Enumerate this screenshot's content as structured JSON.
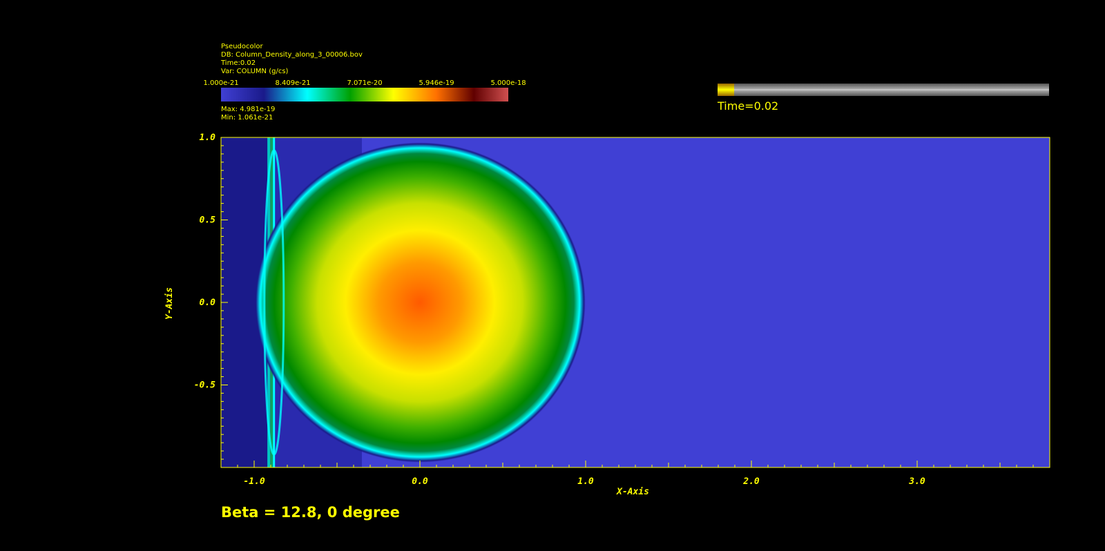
{
  "legend": {
    "plot_type": "Pseudocolor",
    "db": "DB: Column_Density_along_3_00006.bov",
    "time": "Time:0.02",
    "var": "Var: COLUMN (g/cs)",
    "ticks": [
      "1.000e-21",
      "8.409e-21",
      "7.071e-20",
      "5.946e-19",
      "5.000e-18"
    ],
    "max": "Max:  4.981e-19",
    "min": "Min:  1.061e-21"
  },
  "time_slider": {
    "label": "Time=0.02",
    "progress": 0.05
  },
  "caption": "Beta = 12.8, 0 degree",
  "colors": {
    "text": "#ffff00",
    "background": "#000000",
    "ambient": "#4040d4",
    "shock": "#1a1a8a"
  },
  "chart_data": {
    "type": "heatmap",
    "xlabel": "X-Axis",
    "ylabel": "Y-Axis",
    "xlim": [
      -1.2,
      3.8
    ],
    "ylim": [
      -1.0,
      1.0
    ],
    "xticks": [
      -1.0,
      0.0,
      1.0,
      2.0,
      3.0
    ],
    "xtick_labels": [
      "-1.0",
      "0.0",
      "1.0",
      "2.0",
      "3.0"
    ],
    "yticks": [
      1.0,
      0.5,
      0.0,
      -0.5
    ],
    "ytick_labels": [
      "1.0",
      "0.5",
      "0.0",
      "-0.5"
    ],
    "cloud": {
      "center": [
        0.0,
        0.0
      ],
      "radius": 0.97
    },
    "shock_front_x": -0.92,
    "colormap": [
      "#3a3ad0",
      "#00ffff",
      "#00a000",
      "#ffff00",
      "#ff6000",
      "#d04040"
    ]
  }
}
